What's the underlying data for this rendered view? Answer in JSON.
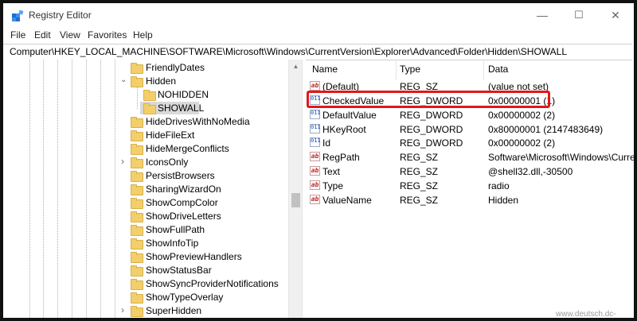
{
  "window": {
    "title": "Registry Editor"
  },
  "window_controls": {
    "minimize": "—",
    "maximize": "☐",
    "close": "✕"
  },
  "menu": [
    "File",
    "Edit",
    "View",
    "Favorites",
    "Help"
  ],
  "address": "Computer\\HKEY_LOCAL_MACHINE\\SOFTWARE\\Microsoft\\Windows\\CurrentVersion\\Explorer\\Advanced\\Folder\\Hidden\\SHOWALL",
  "tree": {
    "items": [
      {
        "label": "FriendlyDates",
        "expander": ""
      },
      {
        "label": "Hidden",
        "expander": "⌄"
      },
      {
        "label": "NOHIDDEN",
        "expander": ""
      },
      {
        "label": "SHOWALL",
        "expander": "",
        "selected": true
      },
      {
        "label": "HideDrivesWithNoMedia",
        "expander": ""
      },
      {
        "label": "HideFileExt",
        "expander": ""
      },
      {
        "label": "HideMergeConflicts",
        "expander": ""
      },
      {
        "label": "IconsOnly",
        "expander": "›"
      },
      {
        "label": "PersistBrowsers",
        "expander": ""
      },
      {
        "label": "SharingWizardOn",
        "expander": ""
      },
      {
        "label": "ShowCompColor",
        "expander": ""
      },
      {
        "label": "ShowDriveLetters",
        "expander": ""
      },
      {
        "label": "ShowFullPath",
        "expander": ""
      },
      {
        "label": "ShowInfoTip",
        "expander": ""
      },
      {
        "label": "ShowPreviewHandlers",
        "expander": ""
      },
      {
        "label": "ShowStatusBar",
        "expander": ""
      },
      {
        "label": "ShowSyncProviderNotifications",
        "expander": ""
      },
      {
        "label": "ShowTypeOverlay",
        "expander": ""
      },
      {
        "label": "SuperHidden",
        "expander": "›"
      }
    ]
  },
  "columns": {
    "name": "Name",
    "type": "Type",
    "data": "Data"
  },
  "values": [
    {
      "icon": "ab",
      "name": "(Default)",
      "type": "REG_SZ",
      "data": "(value not set)"
    },
    {
      "icon": "011",
      "name": "CheckedValue",
      "type": "REG_DWORD",
      "data": "0x00000001 (1)"
    },
    {
      "icon": "011",
      "name": "DefaultValue",
      "type": "REG_DWORD",
      "data": "0x00000002 (2)"
    },
    {
      "icon": "011",
      "name": "HKeyRoot",
      "type": "REG_DWORD",
      "data": "0x80000001 (2147483649)"
    },
    {
      "icon": "011",
      "name": "Id",
      "type": "REG_DWORD",
      "data": "0x00000002 (2)"
    },
    {
      "icon": "ab",
      "name": "RegPath",
      "type": "REG_SZ",
      "data": "Software\\Microsoft\\Windows\\CurrentVersion\\Explorer\\Advanced"
    },
    {
      "icon": "ab",
      "name": "Text",
      "type": "REG_SZ",
      "data": "@shell32.dll,-30500"
    },
    {
      "icon": "ab",
      "name": "Type",
      "type": "REG_SZ",
      "data": "radio"
    },
    {
      "icon": "ab",
      "name": "ValueName",
      "type": "REG_SZ",
      "data": "Hidden"
    }
  ],
  "watermark": "www.deutsch.dc-z.com",
  "colors": {
    "highlight": "#e01818",
    "folder": "#f2cf6b",
    "selection": "#d9d9d9"
  }
}
